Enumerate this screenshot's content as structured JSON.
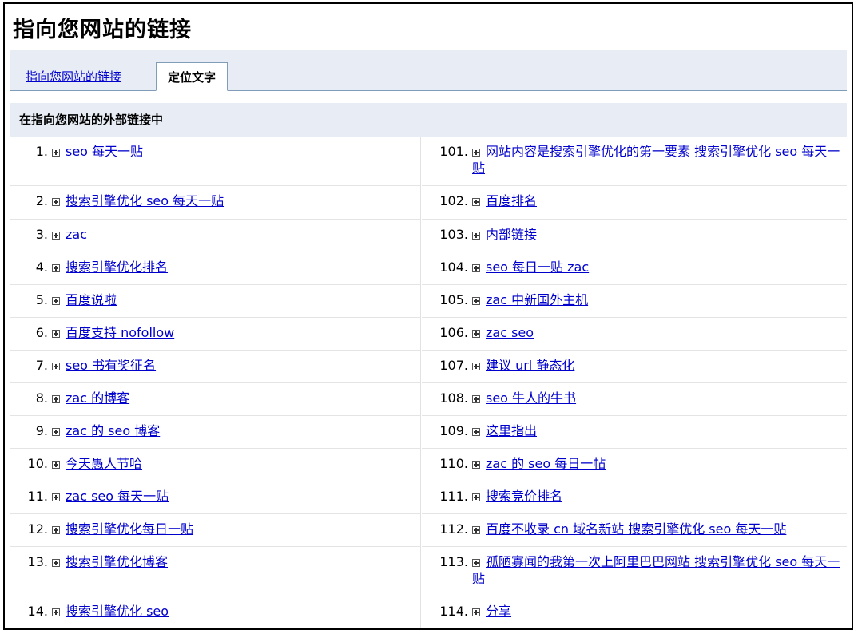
{
  "page_title": "指向您网站的链接",
  "tabs": [
    {
      "label": "指向您网站的链接",
      "active": false
    },
    {
      "label": "定位文字",
      "active": true
    }
  ],
  "section_header": "在指向您网站的外部链接中",
  "left_column": [
    {
      "num": "1.",
      "text": "seo 每天一贴"
    },
    {
      "num": "2.",
      "text": "搜索引擎优化 seo 每天一贴"
    },
    {
      "num": "3.",
      "text": "zac"
    },
    {
      "num": "4.",
      "text": "搜索引擎优化排名"
    },
    {
      "num": "5.",
      "text": "百度说啦"
    },
    {
      "num": "6.",
      "text": "百度支持 nofollow"
    },
    {
      "num": "7.",
      "text": "seo 书有奖征名"
    },
    {
      "num": "8.",
      "text": "zac 的博客"
    },
    {
      "num": "9.",
      "text": "zac 的 seo 博客"
    },
    {
      "num": "10.",
      "text": "今天愚人节哈"
    },
    {
      "num": "11.",
      "text": "zac seo 每天一贴"
    },
    {
      "num": "12.",
      "text": "搜索引擎优化每日一贴"
    },
    {
      "num": "13.",
      "text": "搜索引擎优化博客"
    },
    {
      "num": "14.",
      "text": "搜索引擎优化 seo"
    }
  ],
  "right_column": [
    {
      "num": "101.",
      "text": "网站内容是搜索引擎优化的第一要素 搜索引擎优化 seo 每天一贴"
    },
    {
      "num": "102.",
      "text": "百度排名"
    },
    {
      "num": "103.",
      "text": "内部链接"
    },
    {
      "num": "104.",
      "text": "seo 每日一贴 zac"
    },
    {
      "num": "105.",
      "text": "zac 中新国外主机"
    },
    {
      "num": "106.",
      "text": "zac seo"
    },
    {
      "num": "107.",
      "text": "建议 url 静态化"
    },
    {
      "num": "108.",
      "text": "seo 牛人的牛书"
    },
    {
      "num": "109.",
      "text": "这里指出"
    },
    {
      "num": "110.",
      "text": "zac 的 seo 每日一帖"
    },
    {
      "num": "111.",
      "text": "搜索竞价排名"
    },
    {
      "num": "112.",
      "text": "百度不收录 cn 域名新站 搜索引擎优化 seo 每天一贴"
    },
    {
      "num": "113.",
      "text": "孤陋寡闻的我第一次上阿里巴巴网站 搜索引擎优化 seo 每天一贴"
    },
    {
      "num": "114.",
      "text": "分享"
    }
  ],
  "icons": {
    "row_expand": "plus-box-icon"
  },
  "colors": {
    "link": "#0000cc",
    "band": "#e8ecf5",
    "tab_border": "#7f9db9"
  }
}
